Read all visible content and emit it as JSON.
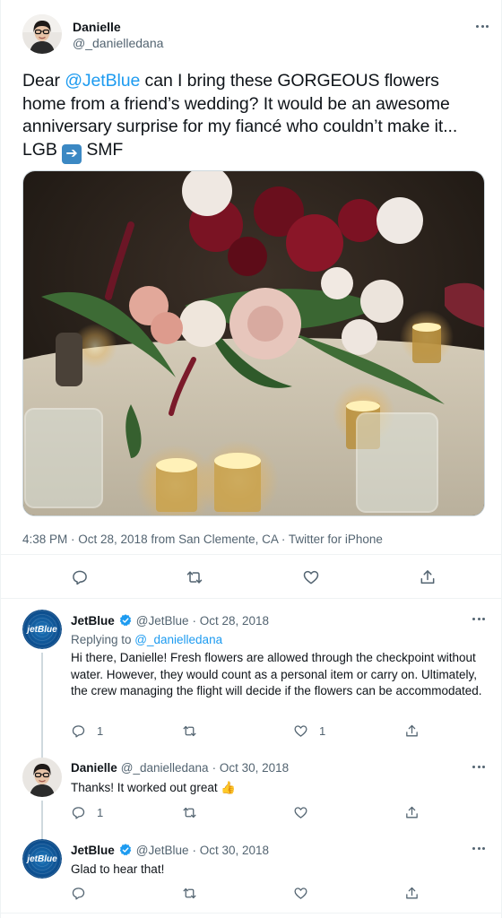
{
  "main_tweet": {
    "author_name": "Danielle",
    "author_handle": "@_danielledana",
    "text_before": "Dear ",
    "mention": "@JetBlue",
    "text_after": " can I bring these GORGEOUS flowers home from a friend’s wedding? It would be an awesome anniversary surprise for my fiancé who couldn’t make it... LGB ",
    "arrow_emoji": "➔",
    "text_end": " SMF",
    "meta": "4:38 PM · Oct 28, 2018 from San Clemente, CA · Twitter for iPhone",
    "photo_icon": "photo-flowers-centerpiece"
  },
  "replies": [
    {
      "author_name": "JetBlue",
      "author_handle": "@JetBlue",
      "date": "· Oct 28, 2018",
      "verified": true,
      "replying_prefix": "Replying to ",
      "replying_to": "@_danielledana",
      "text": "Hi there, Danielle! Fresh flowers are allowed through the checkpoint without water. However, they would count as a personal item or carry on. Ultimately, the crew managing the flight will decide if the flowers can be accommodated.",
      "reply_count": "1",
      "retweet_count": "",
      "like_count": "1",
      "avatar_text": "jetBlue"
    },
    {
      "author_name": "Danielle",
      "author_handle": "@_danielledana",
      "date": "· Oct 30, 2018",
      "text": "Thanks! It worked out great",
      "emoji": "👍",
      "reply_count": "1",
      "retweet_count": "",
      "like_count": ""
    },
    {
      "author_name": "JetBlue",
      "author_handle": "@JetBlue",
      "date": "· Oct 30, 2018",
      "verified": true,
      "text": "Glad to hear that!",
      "reply_count": "",
      "retweet_count": "",
      "like_count": "",
      "avatar_text": "jetBlue"
    }
  ],
  "colors": {
    "accent": "#1d9bf0",
    "text": "#0f1419",
    "muted": "#536471",
    "border": "#eff3f4"
  }
}
